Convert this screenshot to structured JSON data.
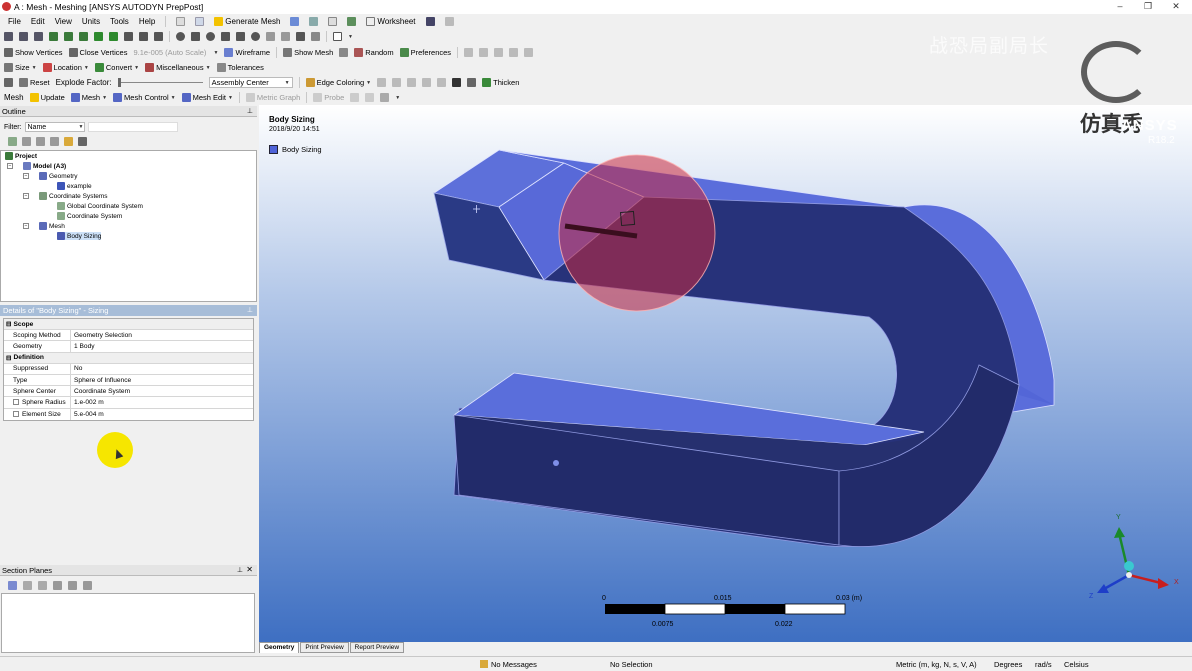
{
  "window": {
    "title": "A : Mesh - Meshing [ANSYS AUTODYN PrepPost]"
  },
  "menu": [
    "File",
    "Edit",
    "View",
    "Units",
    "Tools",
    "Help"
  ],
  "toolbar1": {
    "generate_mesh": "Generate Mesh",
    "worksheet": "Worksheet"
  },
  "toolbar2": {
    "show_vertices": "Show Vertices",
    "close_vertices": "Close Vertices",
    "auto_scale": "9.1e-005 (Auto Scale)",
    "wireframe": "Wireframe",
    "show_mesh": "Show Mesh",
    "random": "Random",
    "preferences": "Preferences"
  },
  "toolbar3": {
    "size": "Size",
    "location": "Location",
    "convert": "Convert",
    "miscellaneous": "Miscellaneous",
    "tolerances": "Tolerances"
  },
  "toolbar4": {
    "reset": "Reset",
    "explode_factor": "Explode Factor:",
    "assembly_center": "Assembly Center",
    "edge_coloring": "Edge Coloring",
    "thicken": "Thicken"
  },
  "toolbar5": {
    "mesh_label": "Mesh",
    "update": "Update",
    "mesh": "Mesh",
    "mesh_control": "Mesh Control",
    "mesh_edit": "Mesh Edit",
    "metric_graph": "Metric Graph",
    "probe": "Probe"
  },
  "outline": {
    "title": "Outline",
    "filter_label": "Filter:",
    "filter_value": "Name",
    "tree": [
      "Project",
      "Model (A3)",
      "Geometry",
      "example",
      "Coordinate Systems",
      "Global Coordinate System",
      "Coordinate System",
      "Mesh",
      "Body Sizing"
    ]
  },
  "details": {
    "title": "Details of \"Body Sizing\" - Sizing",
    "sections": {
      "scope": "Scope",
      "definition": "Definition"
    },
    "rows": [
      {
        "k": "Scoping Method",
        "v": "Geometry Selection"
      },
      {
        "k": "Geometry",
        "v": "1 Body"
      },
      {
        "k": "Suppressed",
        "v": "No"
      },
      {
        "k": "Type",
        "v": "Sphere of Influence"
      },
      {
        "k": "Sphere Center",
        "v": "Coordinate System"
      },
      {
        "k": "Sphere Radius",
        "v": "1.e-002 m"
      },
      {
        "k": "Element Size",
        "v": "5.e-004 m"
      }
    ]
  },
  "section_planes": {
    "title": "Section Planes"
  },
  "viewport": {
    "label_title": "Body Sizing",
    "label_date": "2018/9/20 14:51",
    "legend": "Body Sizing",
    "legend_color": "#4f63d8",
    "brand": "ANSYS",
    "version": "R18.2",
    "watermark_cn": "仿真秀",
    "watermark_top": "战恐局副局长",
    "scale": {
      "top": [
        "0",
        "0.015",
        "0.03 (m)"
      ],
      "bottom": [
        "0.0075",
        "0.022"
      ]
    },
    "triad": {
      "x": "X",
      "y": "Y",
      "z": "Z"
    }
  },
  "tabs": [
    "Geometry",
    "Print Preview",
    "Report Preview"
  ],
  "status": {
    "messages": "No Messages",
    "selection": "No Selection",
    "units": "Metric (m, kg, N, s, V, A)",
    "degrees": "Degrees",
    "rads": "rad/s",
    "temp": "Celsius"
  }
}
